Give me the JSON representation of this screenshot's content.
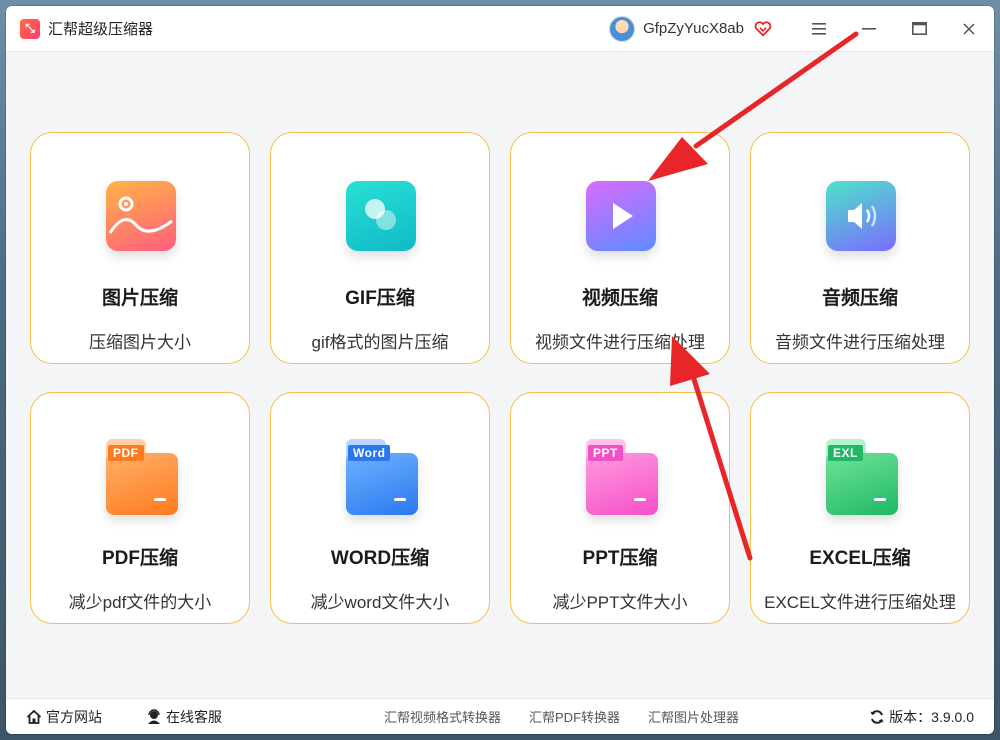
{
  "app": {
    "title": "汇帮超级压缩器",
    "username": "GfpZyYucX8ab"
  },
  "window_controls": {
    "menu": "≡",
    "minimize": "—",
    "maximize": "☐",
    "close": "✕"
  },
  "tools": [
    {
      "title": "图片压缩",
      "desc": "压缩图片大小",
      "icon": "image-icon"
    },
    {
      "title": "GIF压缩",
      "desc": "gif格式的图片压缩",
      "icon": "gif-icon"
    },
    {
      "title": "视频压缩",
      "desc": "视频文件进行压缩处理",
      "icon": "video-play-icon"
    },
    {
      "title": "音频压缩",
      "desc": "音频文件进行压缩处理",
      "icon": "audio-speaker-icon"
    },
    {
      "title": "PDF压缩",
      "desc": "减少pdf文件的大小",
      "icon": "pdf-folder-icon",
      "label": "PDF"
    },
    {
      "title": "WORD压缩",
      "desc": "减少word文件大小",
      "icon": "word-folder-icon",
      "label": "Word"
    },
    {
      "title": "PPT压缩",
      "desc": "减少PPT文件大小",
      "icon": "ppt-folder-icon",
      "label": "PPT"
    },
    {
      "title": "EXCEL压缩",
      "desc": "EXCEL文件进行压缩处理",
      "icon": "excel-folder-icon",
      "label": "EXL"
    }
  ],
  "footer": {
    "website": "官方网站",
    "support": "在线客服",
    "links": [
      "汇帮视频格式转换器",
      "汇帮PDF转换器",
      "汇帮图片处理器"
    ],
    "version_label": "版本：",
    "version": "3.9.0.0"
  },
  "colors": {
    "card_border": "#f5c04a",
    "arrow": "#e8262a"
  }
}
